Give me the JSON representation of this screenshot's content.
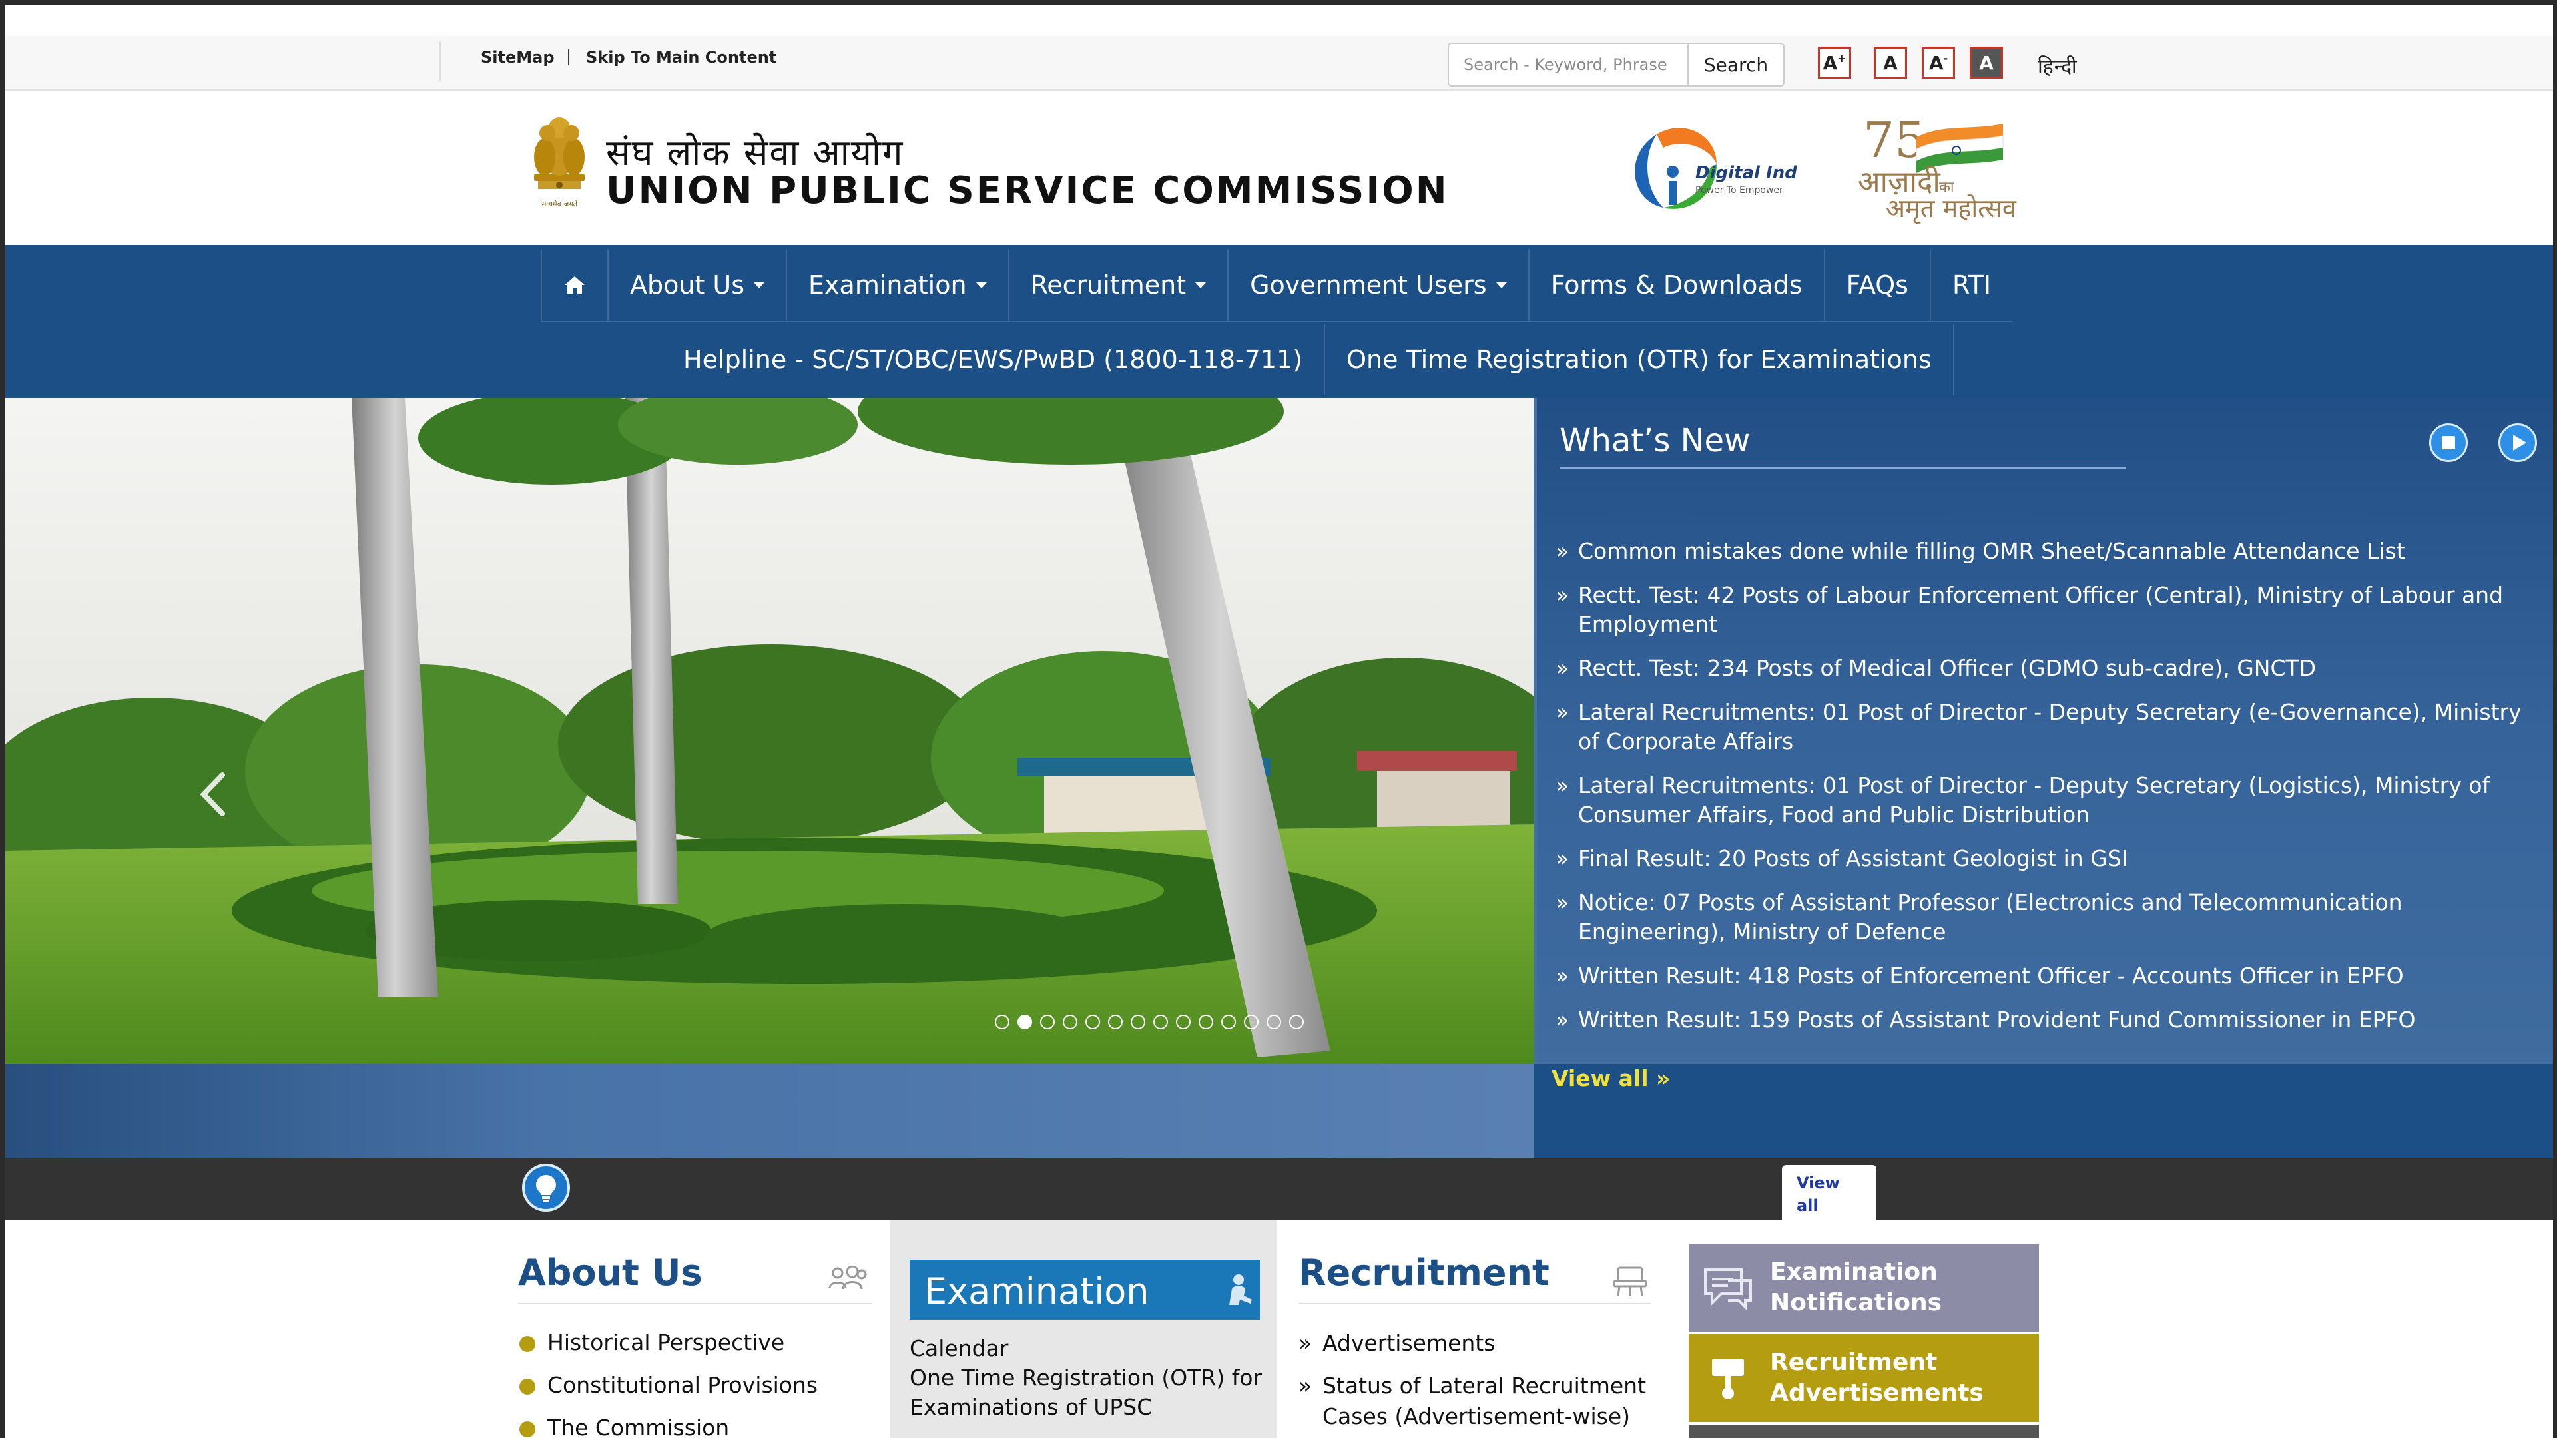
{
  "colors": {
    "primary_blue": "#1b4f86",
    "accent_gold": "#b59d12",
    "view_all_yellow": "#f0e13c",
    "tile_notifications": "#8c8ca6",
    "tile_advertisements": "#b59d12",
    "exam_blue": "#1b78b8",
    "dark_strip": "#333333"
  },
  "utility_bar": {
    "sitemap": "SiteMap",
    "separator": "|",
    "skip_to_main": "Skip To Main Content",
    "search_placeholder": "Search - Keyword, Phrase",
    "search_button": "Search",
    "font_increase": "A",
    "font_increase_sup": "+",
    "font_normal": "A",
    "font_decrease": "A",
    "font_decrease_sup": "-",
    "font_contrast": "A",
    "language_link": "हिन्दी"
  },
  "header": {
    "title_hindi": "संघ लोक सेवा आयोग",
    "title_english": "UNION PUBLIC SERVICE COMMISSION",
    "emblem_caption": "सत्यमेव जयते",
    "digital_india_title": "Digital India",
    "digital_india_tagline": "Power To Empower",
    "azadi_line1": "आज़ादी",
    "azadi_ka": "का",
    "azadi_line2": "अमृत महोत्सव"
  },
  "nav": {
    "home_icon": "home-icon",
    "row1": [
      {
        "label": "About Us",
        "dropdown": true
      },
      {
        "label": "Examination",
        "dropdown": true
      },
      {
        "label": "Recruitment",
        "dropdown": true
      },
      {
        "label": "Government Users",
        "dropdown": true
      },
      {
        "label": "Forms & Downloads",
        "dropdown": false
      },
      {
        "label": "FAQs",
        "dropdown": false
      },
      {
        "label": "RTI",
        "dropdown": false
      }
    ],
    "row2": [
      {
        "label": "Helpline - SC/ST/OBC/EWS/PwBD (1800-118-711)"
      },
      {
        "label": "One Time Registration (OTR) for Examinations"
      }
    ]
  },
  "slider": {
    "total_slides": 14,
    "active_slide": 2
  },
  "whats_new": {
    "title": "What’s New",
    "items": [
      "Common mistakes done while filling OMR Sheet/Scannable Attendance List",
      "Rectt. Test: 42 Posts of Labour Enforcement Officer (Central), Ministry of Labour and Employment",
      "Rectt. Test: 234 Posts of Medical Officer (GDMO sub-cadre), GNCTD",
      "Lateral Recruitments: 01 Post of Director - Deputy Secretary (e-Governance), Ministry of Corporate Affairs",
      "Lateral Recruitments: 01 Post of Director - Deputy Secretary (Logistics), Ministry of Consumer Affairs, Food and Public Distribution",
      "Final Result: 20 Posts of Assistant Geologist in GSI",
      "Notice: 07 Posts of Assistant Professor (Electronics and Telecommunication Engineering), Ministry of Defence",
      "Written Result: 418 Posts of Enforcement Officer - Accounts Officer in EPFO",
      "Written Result: 159 Posts of Assistant Provident Fund Commissioner in EPFO"
    ],
    "view_all": "View all »"
  },
  "strip": {
    "view_all": "View all"
  },
  "about_us": {
    "title": "About Us",
    "items": [
      "Historical Perspective",
      "Constitutional Provisions",
      "The Commission"
    ]
  },
  "examination": {
    "title": "Examination",
    "links": [
      "Calendar",
      "One Time Registration (OTR) for Examinations of UPSC"
    ]
  },
  "recruitment": {
    "title": "Recruitment",
    "items": [
      "Advertisements",
      "Status of Lateral Recruitment Cases (Advertisement-wise)"
    ]
  },
  "quick_tiles": [
    {
      "label": "Examination Notifications"
    },
    {
      "label": "Recruitment Advertisements"
    }
  ]
}
